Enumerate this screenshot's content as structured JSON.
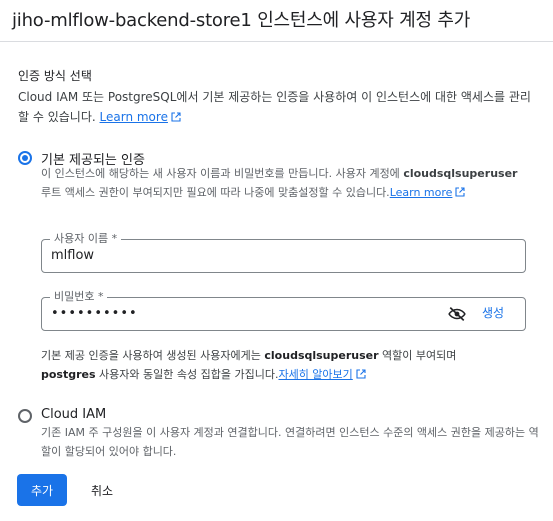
{
  "dialog": {
    "title": "jiho-mlflow-backend-store1 인스턴스에 사용자 계정 추가"
  },
  "auth_section": {
    "label": "인증 방식 선택",
    "description": "Cloud IAM 또는 PostgreSQL에서 기본 제공하는 인증을 사용하여 이 인스턴스에 대한 액세스를 관리할 수 있습니다.",
    "learn_more": "Learn more"
  },
  "builtin_option": {
    "title": "기본 제공되는 인증",
    "desc_part1": "이 인스턴스에 해당하는 새 사용자 이름과 비밀번호를 만듭니다. 사용자 계정에 ",
    "desc_bold": "cloudsqlsuperuser",
    "desc_part2": " 루트 액세스 권한이 부여되지만 필요에 따라 나중에 맞춤설정할 수 있습니다.",
    "learn_more": "Learn more",
    "selected": true
  },
  "username_field": {
    "label": "사용자 이름 *",
    "value": "mlflow"
  },
  "password_field": {
    "label": "비밀번호 *",
    "value": "••••••••••",
    "generate_label": "생성",
    "visibility_icon": "visibility-off-icon"
  },
  "note": {
    "part1": "기본 제공 인증을 사용하여 생성된 사용자에게는 ",
    "bold1": "cloudsqlsuperuser",
    "part2": " 역할이 부여되며 ",
    "bold2": "postgres",
    "part3": " 사용자와 동일한 속성 집합을 가집니다.",
    "link": "자세히 알아보기"
  },
  "iam_option": {
    "title": "Cloud IAM",
    "description": "기존 IAM 주 구성원을 이 사용자 계정과 연결합니다. 연결하려면 인스턴스 수준의 액세스 권한을 제공하는 역할이 할당되어 있어야 합니다.",
    "selected": false
  },
  "actions": {
    "add_label": "추가",
    "cancel_label": "취소"
  },
  "colors": {
    "accent": "#1a73e8",
    "text": "#202124",
    "muted": "#5f6368"
  }
}
